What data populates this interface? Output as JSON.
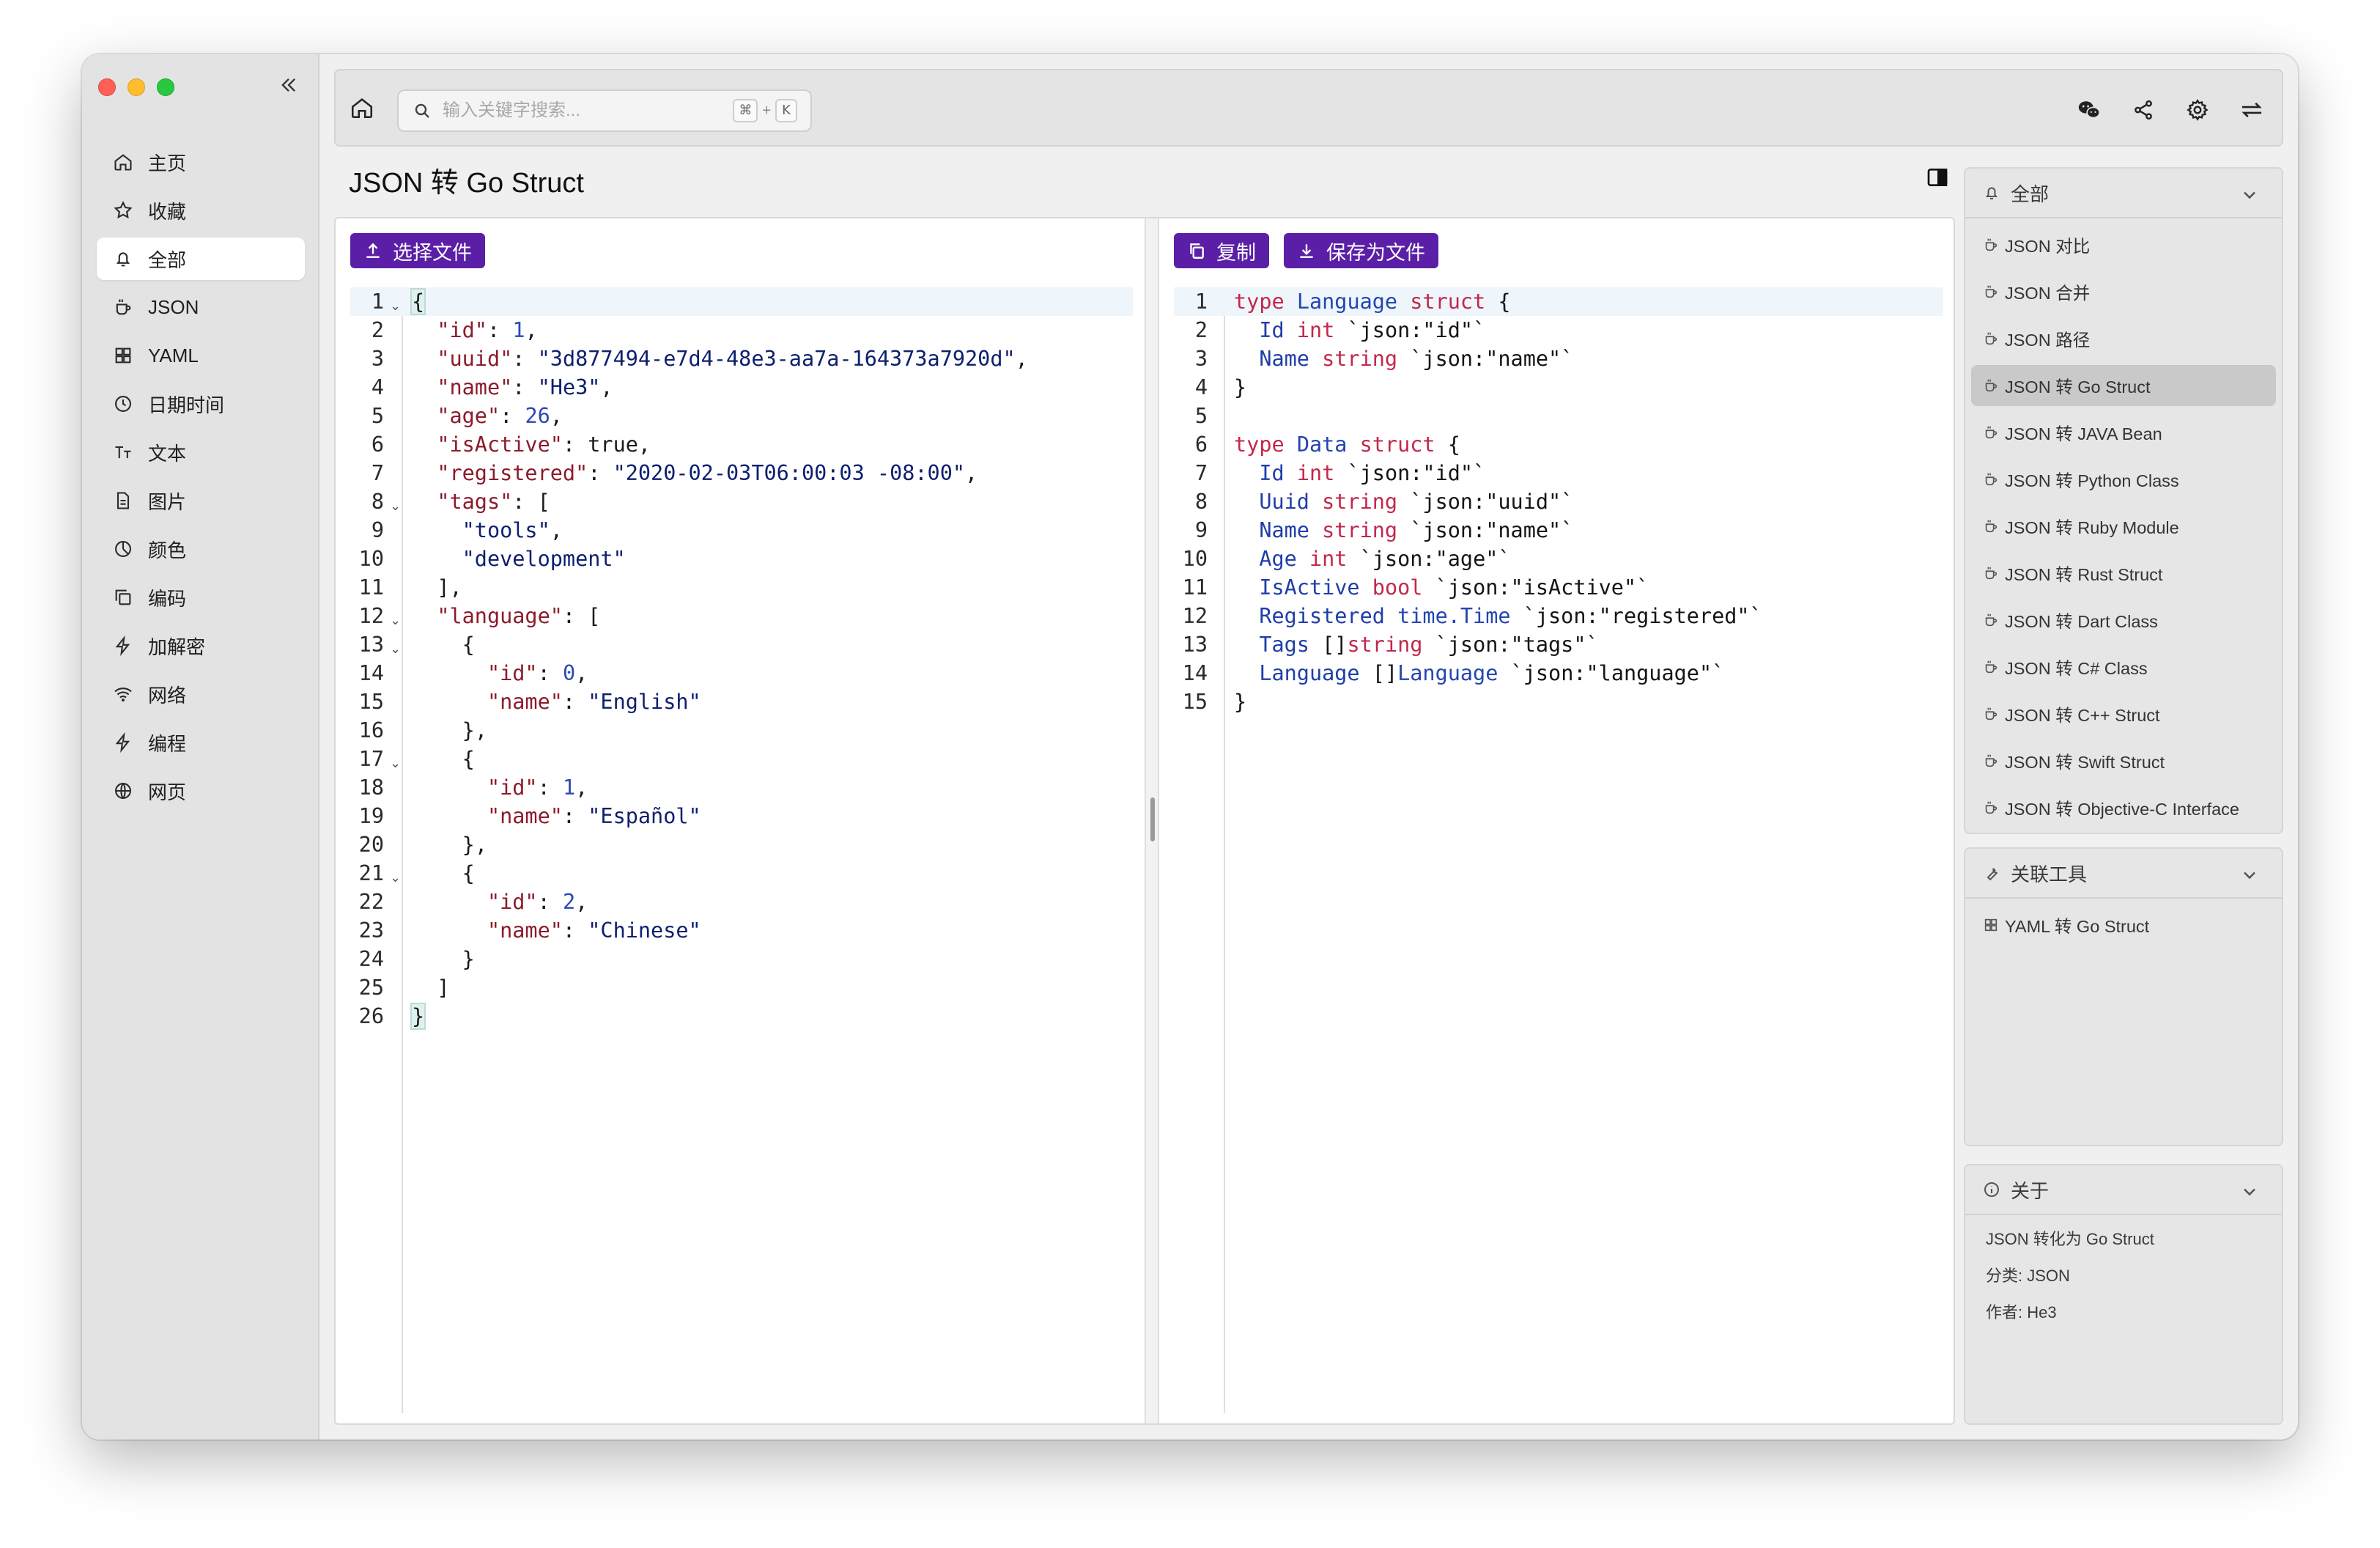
{
  "sidebar": {
    "items": [
      {
        "label": "主页",
        "icon": "home-icon"
      },
      {
        "label": "收藏",
        "icon": "star-icon"
      },
      {
        "label": "全部",
        "icon": "bell-icon",
        "active": true
      },
      {
        "label": "JSON",
        "icon": "cup-icon"
      },
      {
        "label": "YAML",
        "icon": "grid-icon"
      },
      {
        "label": "日期时间",
        "icon": "clock-icon"
      },
      {
        "label": "文本",
        "icon": "text-icon"
      },
      {
        "label": "图片",
        "icon": "file-image-icon"
      },
      {
        "label": "颜色",
        "icon": "pie-icon"
      },
      {
        "label": "编码",
        "icon": "copy-icon"
      },
      {
        "label": "加解密",
        "icon": "bolt-icon"
      },
      {
        "label": "网络",
        "icon": "wifi-icon"
      },
      {
        "label": "编程",
        "icon": "bolt-icon"
      },
      {
        "label": "网页",
        "icon": "globe-icon"
      }
    ]
  },
  "search": {
    "placeholder": "输入关键字搜索...",
    "kbd_cmd": "⌘",
    "kbd_plus": "+",
    "kbd_key": "K"
  },
  "page": {
    "title": "JSON 转 Go Struct"
  },
  "left_editor": {
    "select_file_label": "选择文件",
    "lines": [
      "{",
      "  \"id\": 1,",
      "  \"uuid\": \"3d877494-e7d4-48e3-aa7a-164373a7920d\",",
      "  \"name\": \"He3\",",
      "  \"age\": 26,",
      "  \"isActive\": true,",
      "  \"registered\": \"2020-02-03T06:00:03 -08:00\",",
      "  \"tags\": [",
      "    \"tools\",",
      "    \"development\"",
      "  ],",
      "  \"language\": [",
      "    {",
      "      \"id\": 0,",
      "      \"name\": \"English\"",
      "    },",
      "    {",
      "      \"id\": 1,",
      "      \"name\": \"Español\"",
      "    },",
      "    {",
      "      \"id\": 2,",
      "      \"name\": \"Chinese\"",
      "    }",
      "  ]",
      "}"
    ],
    "fold_lines": [
      1,
      8,
      12,
      13,
      17,
      21
    ]
  },
  "right_editor": {
    "copy_label": "复制",
    "save_label": "保存为文件",
    "lines": [
      "type Language struct {",
      "  Id int `json:\"id\"`",
      "  Name string `json:\"name\"`",
      "}",
      "",
      "type Data struct {",
      "  Id int `json:\"id\"`",
      "  Uuid string `json:\"uuid\"`",
      "  Name string `json:\"name\"`",
      "  Age int `json:\"age\"`",
      "  IsActive bool `json:\"isActive\"`",
      "  Registered time.Time `json:\"registered\"`",
      "  Tags []string `json:\"tags\"`",
      "  Language []Language `json:\"language\"`",
      "}"
    ]
  },
  "panels": {
    "all": {
      "title": "全部",
      "items": [
        "JSON 对比",
        "JSON 合并",
        "JSON 路径",
        "JSON 转 Go Struct",
        "JSON 转 JAVA Bean",
        "JSON 转 Python Class",
        "JSON 转 Ruby Module",
        "JSON 转 Rust Struct",
        "JSON 转 Dart Class",
        "JSON 转 C# Class",
        "JSON 转 C++ Struct",
        "JSON 转 Swift Struct",
        "JSON 转 Objective-C Interface"
      ],
      "active_index": 3
    },
    "related": {
      "title": "关联工具",
      "items": [
        "YAML 转 Go Struct"
      ]
    },
    "about": {
      "title": "关于",
      "description": "JSON 转化为 Go Struct",
      "category": "分类: JSON",
      "author": "作者: He3"
    }
  },
  "colors": {
    "accent": "#5a1fa6",
    "json_key": "#8c1b2b",
    "go_keyword": "#c2284b",
    "go_type": "#2346b0"
  }
}
